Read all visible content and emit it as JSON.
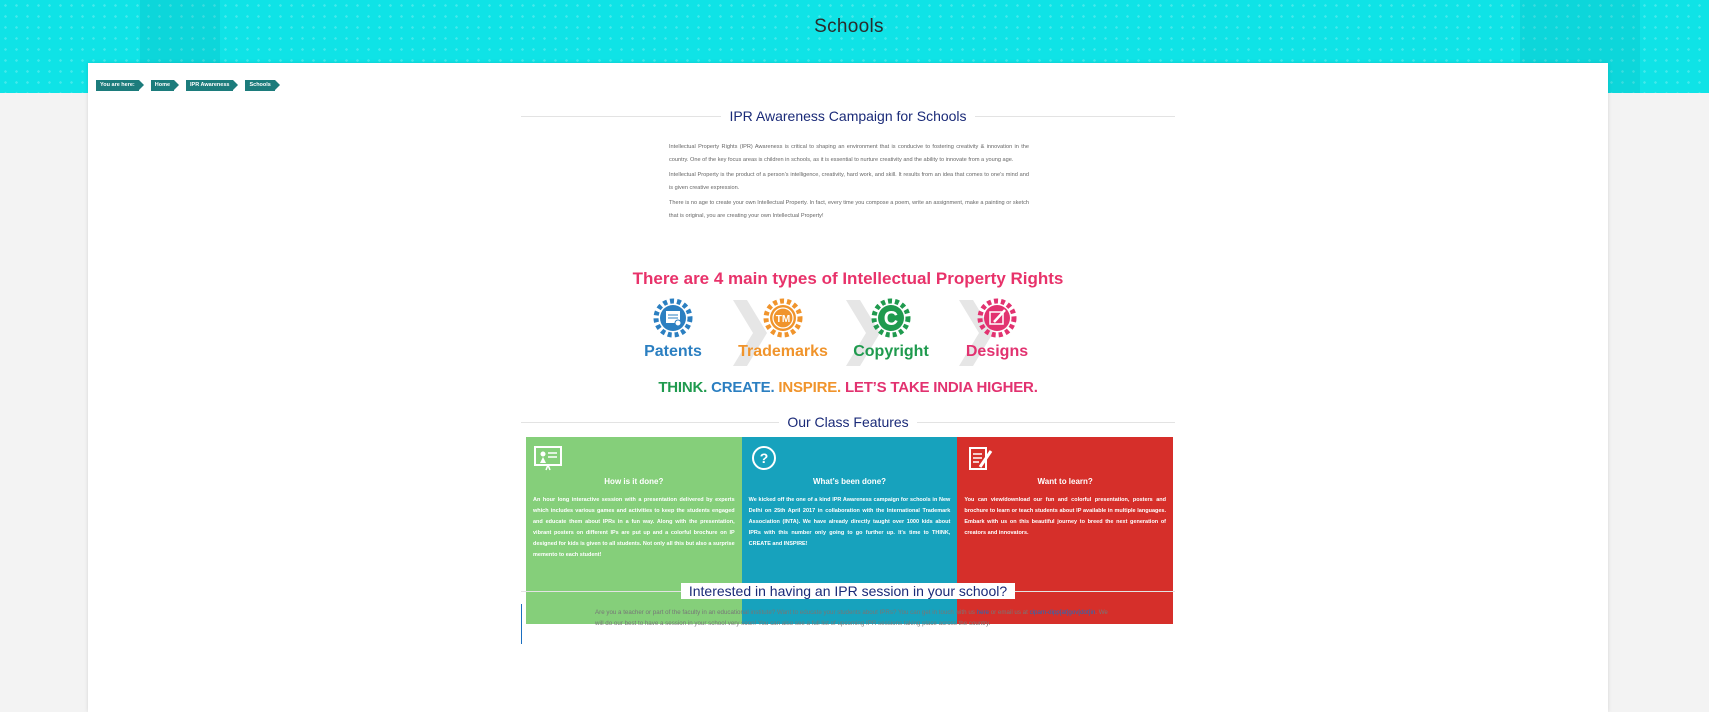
{
  "page": {
    "title": "Schools"
  },
  "breadcrumb": [
    "You are here:",
    "Home",
    "IPR Awareness",
    "Schools"
  ],
  "headings": {
    "campaign": "IPR Awareness Campaign for Schools",
    "features": "Our Class Features",
    "interested": "Interested in having an IPR session in your school?"
  },
  "intro": [
    "Intellectual Property Rights (IPR) Awareness is critical to shaping an environment that is conducive to fostering creativity & innovation in the country. One of the key focus areas is children in schools, as it is essential to nurture creativity and the ability to innovate from a young age.",
    "Intellectual Property is the product of a person’s intelligence, creativity, hard work, and skill. It results from an idea that comes to one’s mind and is given creative expression.",
    "There is no age to create your own Intellectual Property. In fact, every time you compose a poem, write an assignment, make a painting or sketch that is original, you are creating your own Intellectual Property!"
  ],
  "ipr_graphic": {
    "title": "There are 4 main types of Intellectual Property Rights",
    "types": [
      {
        "label": "Patents",
        "icon": "patent-certificate-icon",
        "color": "#2b7fc1"
      },
      {
        "label": "Trademarks",
        "icon": "tm-icon",
        "color": "#f0942c"
      },
      {
        "label": "Copyright",
        "icon": "copyright-icon",
        "color": "#1f9a4e"
      },
      {
        "label": "Designs",
        "icon": "design-pencil-icon",
        "color": "#e23270"
      }
    ],
    "slogan": [
      {
        "text": "THINK.",
        "color": "#1f9a4e"
      },
      {
        "text": "CREATE.",
        "color": "#2b7fc1"
      },
      {
        "text": "INSPIRE.",
        "color": "#f0942c"
      },
      {
        "text": "LET’S TAKE INDIA HIGHER.",
        "color": "#e23270"
      }
    ]
  },
  "features": [
    {
      "title": "How is it done?",
      "icon": "presentation-board-icon",
      "color": "#85cf7a",
      "body": "An hour long interactive session with a presentation delivered by experts which includes various games and activities to keep the students engaged and educate them about IPRs in a fun way. Along with the presentation, vibrant posters on different IPs are put up and a colorful brochure on IP designed for kids is given to all students. Not only all this but also a surprise memento to each student!"
    },
    {
      "title": "What’s been done?",
      "icon": "question-circle-icon",
      "color": "#17a2bd",
      "body": "We kicked off the one of a kind IPR Awareness campaign for schools in New Delhi on 25th April 2017 in collaboration with the International Trademark Association (INTA). We have already directly taught over 1000 kids about IPRs with this number only going to go further up. It's time to THINK, CREATE and INSPIRE!"
    },
    {
      "title": "Want to learn?",
      "icon": "notepad-pencil-icon",
      "color": "#d62f2a",
      "body": "You can view/download our fun and colorful presentation, posters and brochure to learn or teach students about IP available in multiple languages. Embark with us on this beautiful journey to breed the next generation of creators and innovators."
    }
  ],
  "contact": {
    "text_before_here": "Are you a teacher or part of the faculty in an educational institute? Want to  educate your students about IPRs? You can get in touch with us ",
    "here_link": "here",
    "text_before_email": " or email us at ",
    "email": "cipam-dipp[at]gov[dot]in",
    "text_after": ". We will do our best to have a session in your school very soon! You can also see a full list of upcoming IPR sessions taking place across the country."
  }
}
